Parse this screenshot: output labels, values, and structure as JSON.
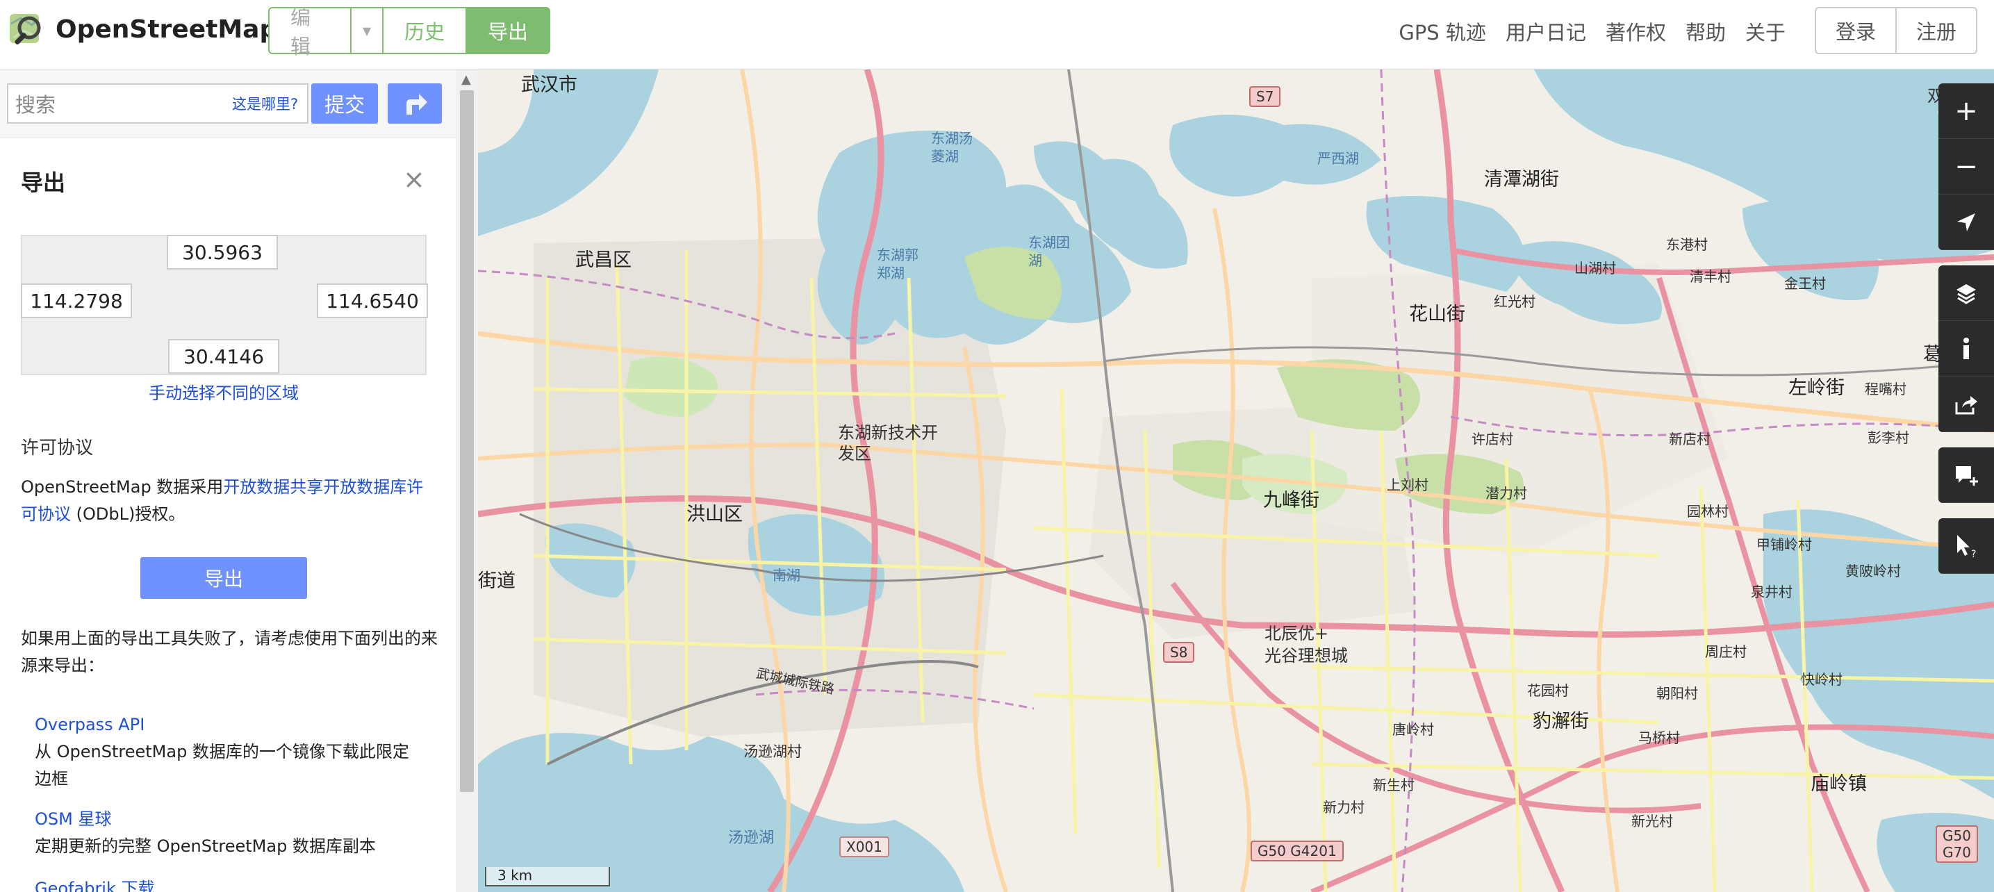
{
  "header": {
    "logo_text": "OpenStreetMap",
    "edit_label": "编辑",
    "history_label": "历史",
    "export_label": "导出",
    "nav": [
      "GPS 轨迹",
      "用户日记",
      "著作权",
      "帮助",
      "关于"
    ],
    "login_label": "登录",
    "signup_label": "注册"
  },
  "search": {
    "placeholder": "搜索",
    "where_link": "这是哪里?",
    "submit_label": "提交"
  },
  "export_panel": {
    "title": "导出",
    "close": "×",
    "max_lat": "30.5963",
    "min_lon": "114.2798",
    "max_lon": "114.6540",
    "min_lat": "30.4146",
    "manual_select": "手动选择不同的区域",
    "license_heading": "许可协议",
    "license_prefix": "OpenStreetMap 数据采用",
    "license_link": "开放数据共享开放数据库许可协议",
    "license_suffix": " (ODbL)授权。",
    "export_button": "导出",
    "fallback_text": "如果用上面的导出工具失败了，请考虑使用下面列出的来源来导出：",
    "sources": [
      {
        "name": "Overpass API",
        "desc": "从 OpenStreetMap 数据库的一个镜像下载此限定边框"
      },
      {
        "name": "OSM 星球",
        "desc": "定期更新的完整 OpenStreetMap 数据库副本"
      },
      {
        "name": "Geofabrik 下载",
        "desc": ""
      }
    ]
  },
  "map": {
    "scale": "3 km",
    "labels": {
      "wuhan": "武汉市",
      "wuchang": "武昌区",
      "hongshan": "洪山区",
      "jiedao": "街道",
      "donghu_tech": "东湖新技术开\n发区",
      "jiufeng": "九峰街",
      "huashan": "花山街",
      "qingtan": "清潭湖街",
      "beichen": "北辰优+\n光谷理想城",
      "baoxie": "豹澥街",
      "zuoling": "左岭街",
      "gedian": "葛店镇",
      "miaoling": "庙岭镇",
      "shuangliu": "双柳街",
      "tangxun": "汤逊湖",
      "tangxun_village": "汤逊湖村",
      "nanhu": "南湖",
      "dongtou_lake": "东湖汤\n菱湖",
      "dongtou_guo": "东湖郭\n郑湖",
      "donghu_tuan": "东湖团\n湖",
      "yanxi": "严西湖",
      "shanhu": "山湖村",
      "hongguang": "红光村",
      "donggang": "东港村",
      "qingfeng": "清丰村",
      "jinwang": "金王村",
      "chengqiao": "程嘴村",
      "pengli": "彭李村",
      "xudian": "许店村",
      "shangliu": "上刘村",
      "qianli": "潜力村",
      "xindian": "新店村",
      "yuanlin": "园林村",
      "jiazhang": "甲铺岭村",
      "huangpo": "黄陂岭村",
      "quanjing": "泉井村",
      "zhouzhuang": "周庄村",
      "xingcun": "快岭村",
      "chaoyang": "朝阳村",
      "huayuan": "花园村",
      "tanglin": "唐岭村",
      "xinsheng": "新生村",
      "xinli": "新力村",
      "majia": "马桥村",
      "xinguang": "新光村",
      "wucheng": "武城城际铁路",
      "s7": "S7",
      "s8": "S8",
      "g50": "G50 G4201",
      "g50b": "G50\nG70",
      "x001": "X001"
    }
  },
  "controls": {
    "zoom_in": "+",
    "zoom_out": "−"
  }
}
